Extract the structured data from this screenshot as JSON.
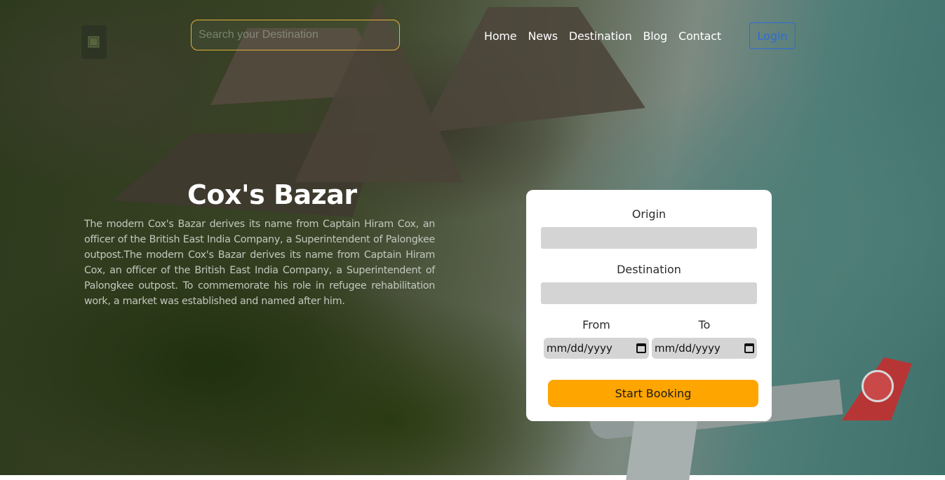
{
  "header": {
    "search_placeholder": "Search your Destination",
    "nav": [
      "Home",
      "News",
      "Destination",
      "Blog",
      "Contact"
    ],
    "login_label": "Login"
  },
  "hero": {
    "title": "Cox's Bazar",
    "description": "The modern Cox's Bazar derives its name from Captain Hiram Cox, an officer of the British East India Company, a Superintendent of Palongkee outpost.The modern Cox's Bazar derives its name from Captain Hiram Cox, an officer of the British East India Company, a Superintendent of Palongkee outpost. To commemorate his role in refugee rehabilitation work, a market was established and named after him."
  },
  "booking": {
    "origin_label": "Origin",
    "destination_label": "Destination",
    "from_label": "From",
    "to_label": "To",
    "from_value": "mm/dd/yyyy",
    "to_value": "mm/dd/yyyy",
    "submit_label": "Start Booking"
  },
  "colors": {
    "accent": "#ffa500",
    "login_border": "#2e6bd6",
    "search_border": "#e3b23a"
  }
}
